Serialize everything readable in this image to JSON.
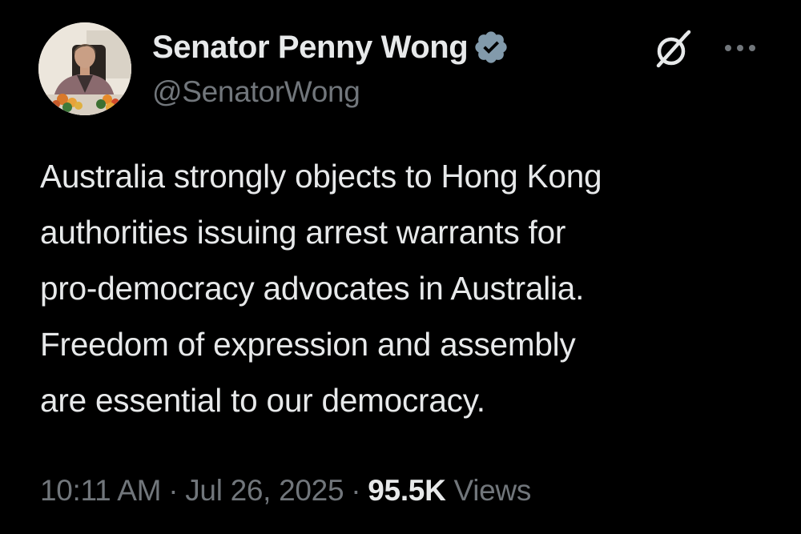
{
  "author": {
    "display_name": "Senator Penny Wong",
    "handle": "@SenatorWong",
    "verified": true,
    "verified_color": "#829aab"
  },
  "tweet": {
    "lines": [
      "Australia strongly objects to Hong Kong",
      "authorities issuing arrest warrants for",
      "pro-democracy advocates in Australia.",
      "Freedom of expression and assembly",
      "are essential to our democracy."
    ]
  },
  "meta": {
    "time": "10:11 AM",
    "separator": "·",
    "date": "Jul 26, 2025",
    "views_count": "95.5K",
    "views_label": "Views"
  },
  "icons": {
    "grok": "grok-icon",
    "more": "more-icon",
    "verified": "verified-badge-icon"
  },
  "colors": {
    "background": "#000000",
    "primary_text": "#e7e9ea",
    "secondary_text": "#71767b"
  }
}
